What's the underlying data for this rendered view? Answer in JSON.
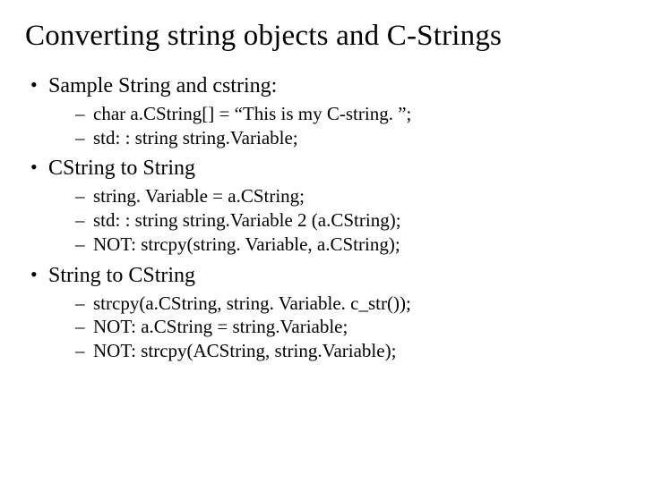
{
  "title": "Converting string objects and C-Strings",
  "bullets": [
    {
      "label": "Sample String and cstring:",
      "sub": [
        "char a.CString[] = “This is my C-string. ”;",
        "std: : string string.Variable;"
      ]
    },
    {
      "label": "CString to String",
      "sub": [
        "string. Variable = a.CString;",
        "std: : string string.Variable 2 (a.CString);",
        "NOT: strcpy(string. Variable, a.CString);"
      ]
    },
    {
      "label": "String to CString",
      "sub": [
        "strcpy(a.CString, string. Variable. c_str());",
        "NOT: a.CString = string.Variable;",
        "NOT: strcpy(ACString, string.Variable);"
      ]
    }
  ]
}
